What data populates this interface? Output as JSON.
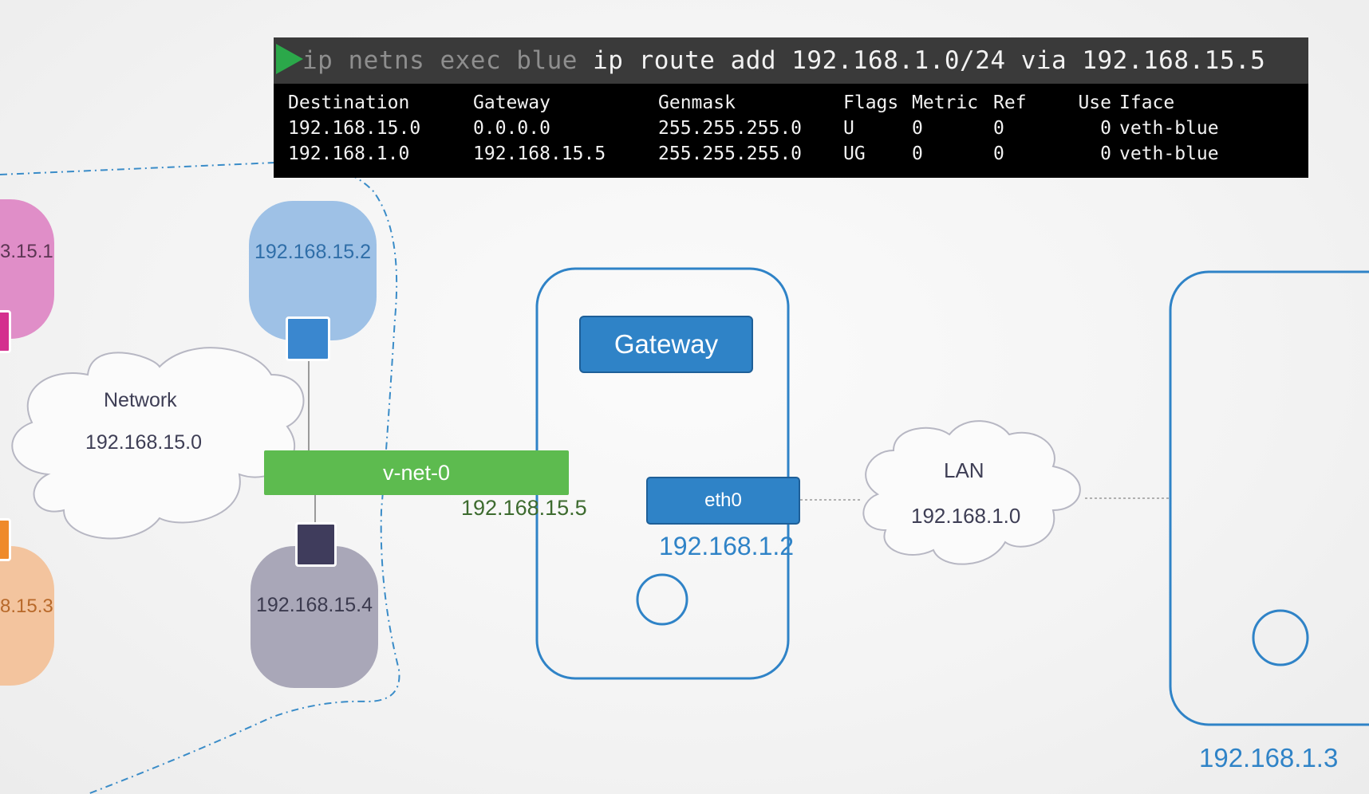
{
  "terminal": {
    "command_prefix": "ip netns exec blue ",
    "command": "ip route add 192.168.1.0/24 via 192.168.15.5",
    "headers": [
      "Destination",
      "Gateway",
      "Genmask",
      "Flags",
      "Metric",
      "Ref",
      "Use",
      "Iface"
    ],
    "rows": [
      [
        "192.168.15.0",
        "0.0.0.0",
        "255.255.255.0",
        "U",
        "0",
        "0",
        "0",
        "veth-blue"
      ],
      [
        "192.168.1.0",
        "192.168.15.5",
        "255.255.255.0",
        "UG",
        "0",
        "0",
        "0",
        "veth-blue"
      ]
    ]
  },
  "namespaces": {
    "pink": {
      "ip": "3.15.1",
      "color": "#e08ec8",
      "port_color": "#d42f8e"
    },
    "blue": {
      "ip": "192.168.15.2",
      "color": "#9ec1e6",
      "port_color": "#3a87cf"
    },
    "grey": {
      "ip": "192.168.15.4",
      "color": "#a9a7b8",
      "port_color": "#3f3c5c"
    },
    "orange": {
      "ip": "8.15.3",
      "color": "#f3c49e",
      "port_color": "#ef8a2a"
    }
  },
  "network_cloud": {
    "name": "Network",
    "subnet": "192.168.15.0"
  },
  "bridge": {
    "name": "v-net-0",
    "ip": "192.168.15.5"
  },
  "gateway_host": {
    "label": "Gateway",
    "interface": "eth0",
    "ip": "192.168.1.2"
  },
  "lan_cloud": {
    "name": "LAN",
    "subnet": "192.168.1.0"
  },
  "remote_host": {
    "ip": "192.168.1.3"
  },
  "colors": {
    "accent_blue": "#2f83c7",
    "bridge_green": "#5dbb4f",
    "ip_green": "#3d6b2f",
    "host_border": "#2f83c7"
  }
}
